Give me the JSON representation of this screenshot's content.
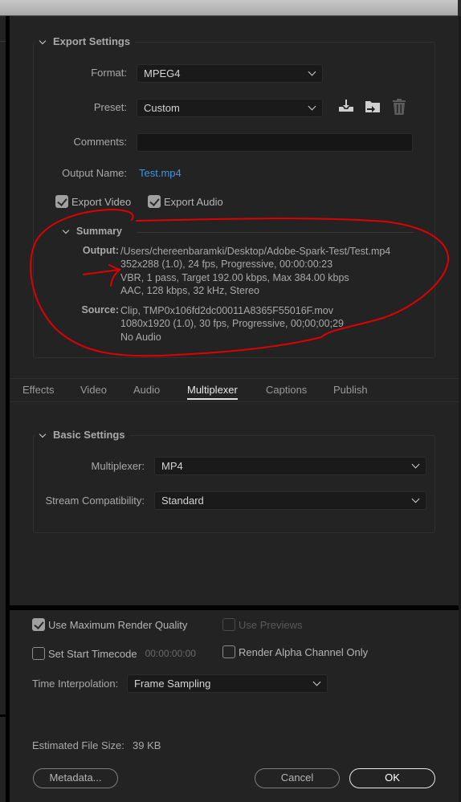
{
  "export_settings": {
    "title": "Export Settings",
    "format_label": "Format:",
    "format_value": "MPEG4",
    "preset_label": "Preset:",
    "preset_value": "Custom",
    "comments_label": "Comments:",
    "comments_value": "",
    "output_name_label": "Output Name:",
    "output_name_value": "Test.mp4",
    "export_video_label": "Export Video",
    "export_video_checked": true,
    "export_audio_label": "Export Audio",
    "export_audio_checked": true,
    "preset_icons": [
      "save-preset-icon",
      "import-preset-icon",
      "delete-preset-icon"
    ]
  },
  "summary": {
    "title": "Summary",
    "output_label": "Output:",
    "output_lines": [
      "/Users/chereenbaramki/Desktop/Adobe-Spark-Test/Test.mp4",
      "352x288 (1.0), 24 fps, Progressive, 00:00:00:23",
      "VBR, 1 pass, Target 192.00 kbps, Max 384.00 kbps",
      "AAC, 128 kbps, 32 kHz, Stereo"
    ],
    "source_label": "Source:",
    "source_lines": [
      "Clip, TMP0x106fd2dc00011A8365F55016F.mov",
      "1080x1920 (1.0), 30 fps, Progressive, 00;00;00;29",
      "No Audio"
    ]
  },
  "tabs": [
    {
      "label": "Effects",
      "active": false
    },
    {
      "label": "Video",
      "active": false
    },
    {
      "label": "Audio",
      "active": false
    },
    {
      "label": "Multiplexer",
      "active": true
    },
    {
      "label": "Captions",
      "active": false
    },
    {
      "label": "Publish",
      "active": false
    }
  ],
  "basic_settings": {
    "title": "Basic Settings",
    "multiplexer_label": "Multiplexer:",
    "multiplexer_value": "MP4",
    "stream_label": "Stream Compatibility:",
    "stream_value": "Standard"
  },
  "render_options": {
    "max_quality_label": "Use Maximum Render Quality",
    "max_quality_checked": true,
    "use_previews_label": "Use Previews",
    "use_previews_checked": false,
    "use_previews_enabled": false,
    "start_timecode_label": "Set Start Timecode",
    "start_timecode_checked": false,
    "start_timecode_value": "00:00:00:00",
    "alpha_label": "Render Alpha Channel Only",
    "alpha_checked": false,
    "time_interp_label": "Time Interpolation:",
    "time_interp_value": "Frame Sampling"
  },
  "footer": {
    "file_size_label": "Estimated File Size:",
    "file_size_value": "39 KB",
    "metadata_button": "Metadata...",
    "cancel_button": "Cancel",
    "ok_button": "OK"
  },
  "annotation": {
    "color": "#e00000"
  }
}
